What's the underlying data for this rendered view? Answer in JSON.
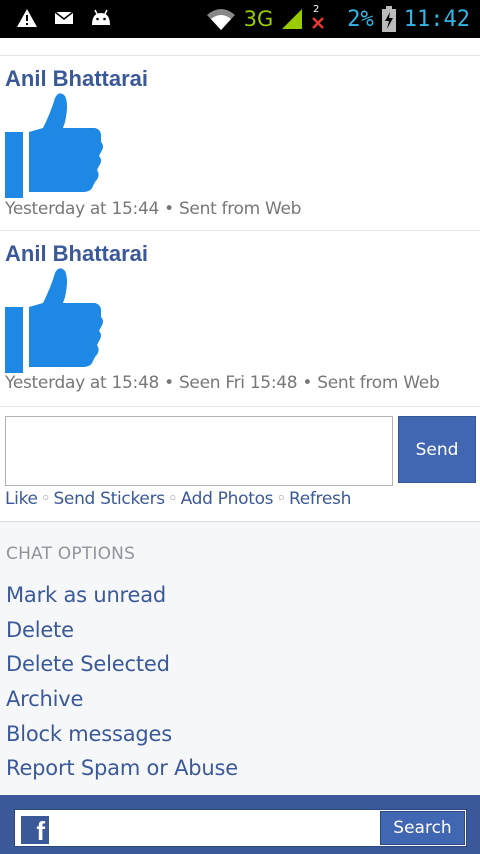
{
  "status_bar": {
    "network": "3G",
    "notification_count": "2",
    "battery": "2%",
    "time": "11:42",
    "icons": [
      "warning-icon",
      "mail-icon",
      "android-icon",
      "wifi-icon",
      "signal-icon",
      "no-sim-icon",
      "battery-charging-icon"
    ]
  },
  "messages": [
    {
      "sender": "Anil Bhattarai",
      "meta": "Yesterday at 15:44 • Sent from Web",
      "sticker": "like-icon"
    },
    {
      "sender": "Anil Bhattarai",
      "meta": "Yesterday at 15:48 • Seen Fri 15:48 • Sent from Web",
      "sticker": "like-icon"
    }
  ],
  "composer": {
    "send_label": "Send",
    "actions": [
      "Like",
      "Send Stickers",
      "Add Photos",
      "Refresh"
    ]
  },
  "chat_options": {
    "heading": "CHAT OPTIONS",
    "items": [
      "Mark as unread",
      "Delete",
      "Delete Selected",
      "Archive",
      "Block messages",
      "Report Spam or Abuse"
    ]
  },
  "bottom_bar": {
    "search_label": "Search",
    "logo_letter": "f"
  },
  "colors": {
    "brand": "#3b5998",
    "button": "#4267b2",
    "like": "#1e88e5"
  }
}
